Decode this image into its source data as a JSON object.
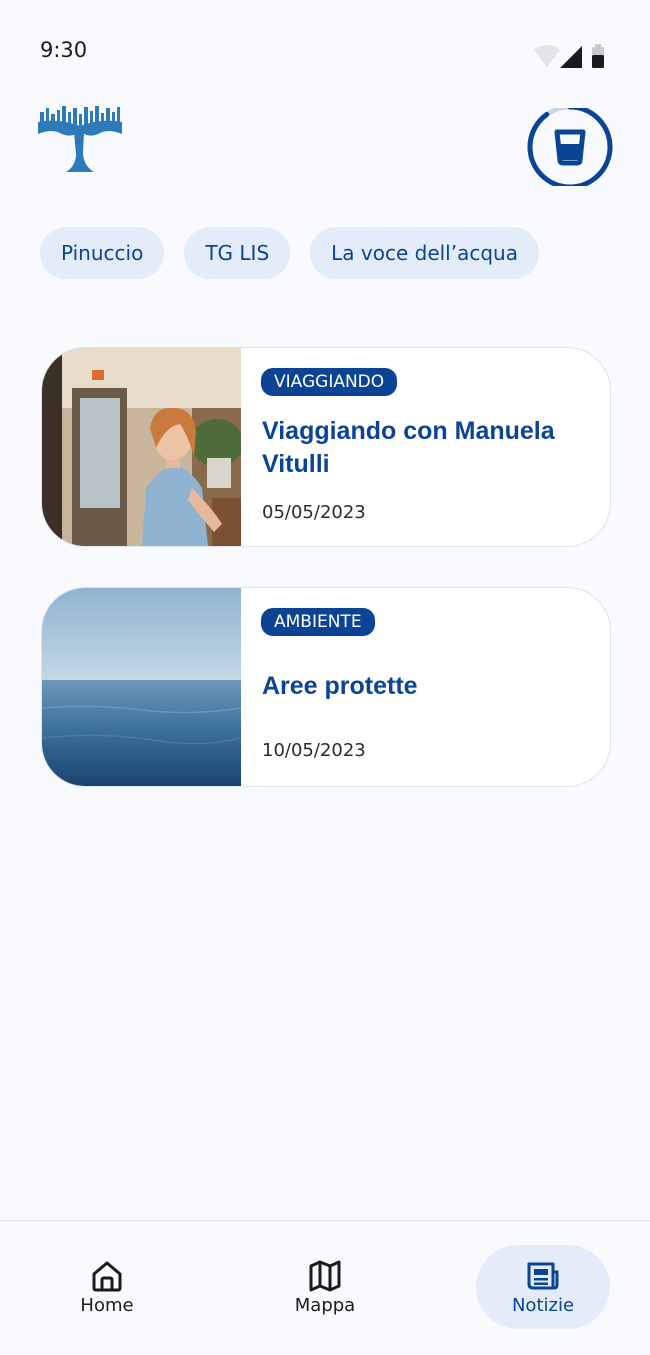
{
  "status_bar": {
    "time": "9:30"
  },
  "header": {
    "logo_icon": "tree-logo-icon",
    "water_button_icon": "water-glass-icon",
    "water_progress": 0.9
  },
  "chips": [
    {
      "label": "Pinuccio"
    },
    {
      "label": "TG LIS"
    },
    {
      "label": "La voce dell’acqua"
    }
  ],
  "news": [
    {
      "category": "VIAGGIANDO",
      "title": "Viaggiando con Manuela Vitulli",
      "date": "05/05/2023"
    },
    {
      "category": "AMBIENTE",
      "title": "Aree protette",
      "date": "10/05/2023"
    }
  ],
  "bottom_nav": {
    "items": [
      {
        "label": "Home",
        "icon": "home-icon"
      },
      {
        "label": "Mappa",
        "icon": "map-icon"
      },
      {
        "label": "Notizie",
        "icon": "newspaper-icon",
        "active": true
      }
    ]
  },
  "colors": {
    "accent": "#0b4494",
    "chip_bg": "#e3ecf8",
    "background": "#f8fafe"
  }
}
